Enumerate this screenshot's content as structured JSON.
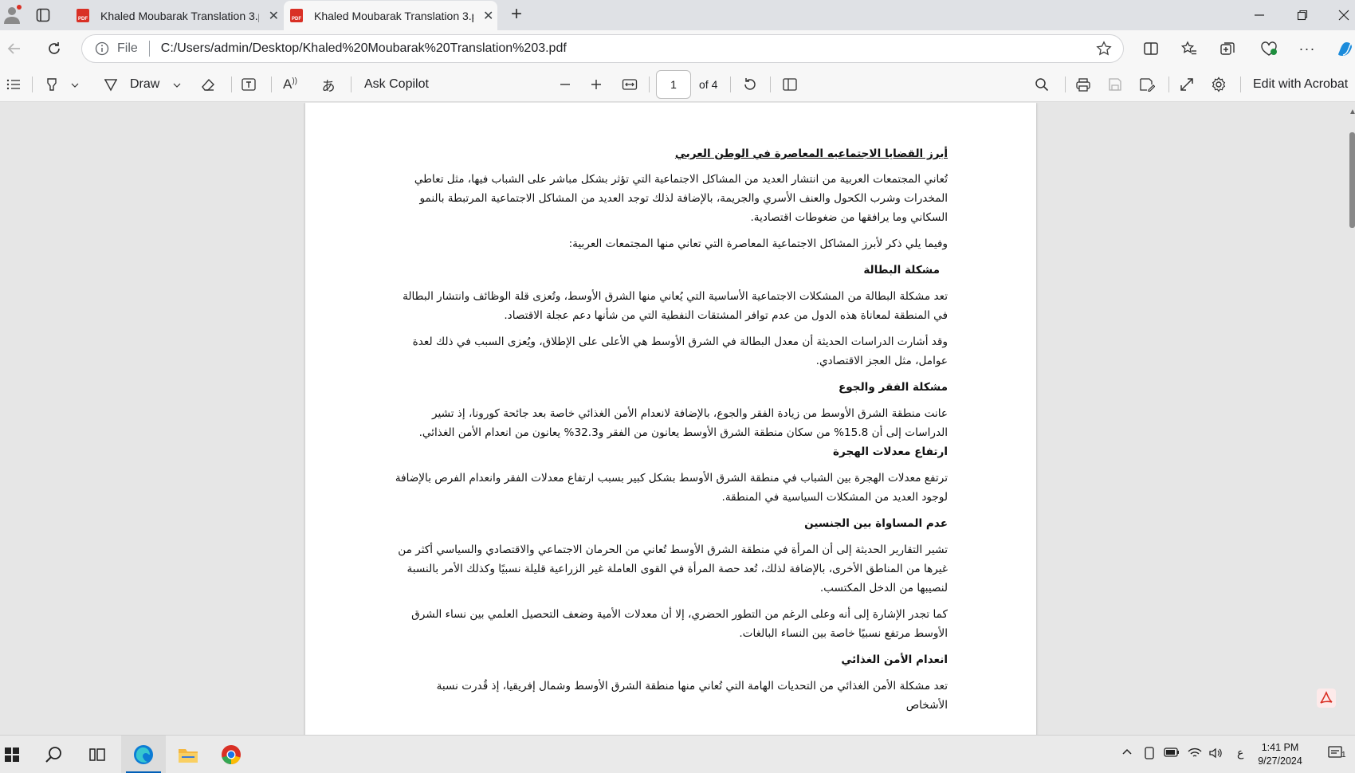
{
  "tabs": [
    {
      "title": "Khaled Moubarak Translation 3.pdf",
      "active": false,
      "icon": "pdf-icon"
    },
    {
      "title": "Khaled Moubarak Translation 3.pdf",
      "active": true,
      "icon": "pdf-icon"
    }
  ],
  "address": {
    "scheme_label": "File",
    "url": "C:/Users/admin/Desktop/Khaled%20Moubarak%20Translation%203.pdf"
  },
  "toolbar": {
    "draw_label": "Draw",
    "ask_copilot": "Ask Copilot",
    "page_current": "1",
    "page_total": "of 4",
    "edit_acrobat": "Edit with Acrobat",
    "pdf_badge": "PDF"
  },
  "document": {
    "title": "أبرز القضايا الاجتماعيه المعاصرة في الوطن العربي",
    "intro": "تُعاني المجتمعات العربية من انتشار العديد من المشاكل الاجتماعية التي تؤثر بشكل مباشر على الشباب فيها، مثل تعاطي المخدرات وشرب الكحول والعنف الأسري والجريمة، بالإضافة لذلك توجد العديد من المشاكل الاجتماعية المرتبطة بالنمو السكاني وما يرافقها من ضغوطات اقتصادية.",
    "lead": "وفيما يلي ذكر لأبرز المشاكل الاجتماعية المعاصرة التي تعاني منها المجتمعات العربية:",
    "h_unemployment": "مشكلة البطالة",
    "p_unemployment_1": "تعد مشكلة البطالة من المشكلات الاجتماعية الأساسية التي يُعاني منها الشرق الأوسط، وتُعزى قلة الوظائف وانتشار البطالة في المنطقة لمعاناة هذه الدول من عدم توافر المشتقات النفطية التي من شأنها دعم عجلة الاقتصاد.",
    "p_unemployment_2": "وقد أشارت الدراسات الحديثة أن معدل البطالة في الشرق الأوسط هي الأعلى على الإطلاق، ويُعزى السبب في ذلك لعدة عوامل، مثل العجز الاقتصادي.",
    "h_poverty": "مشكلة الفقر والجوع",
    "p_poverty": "عانت منطقة الشرق الأوسط من زيادة الفقر والجوع، بالإضافة لانعدام الأمن الغذائي خاصة بعد جائحة كورونا، إذ تشير الدراسات إلى أن 15.8% من سكان منطقة الشرق الأوسط يعانون من الفقر و32.3% يعانون من انعدام الأمن الغذائي.",
    "h_migration": "ارتفاع معدلات الهجرة",
    "p_migration": "ترتفع معدلات الهجرة بين الشباب في منطقة الشرق الأوسط بشكل كبير بسبب ارتفاع معدلات الفقر وانعدام الفرص بالإضافة لوجود العديد من المشكلات السياسية في المنطقة.",
    "h_inequality": "عدم المساواة بين الجنسين",
    "p_inequality_1": "تشير التقارير الحديثة إلى أن المرأة في منطقة الشرق الأوسط تُعاني من الحرمان الاجتماعي والاقتصادي والسياسي أكثر من غيرها من المناطق الأخرى، بالإضافة لذلك، تُعد حصة المرأة في القوى العاملة غير الزراعية قليلة نسبيًا وكذلك الأمر بالنسبة لنصيبها من الدخل المكتسب.",
    "p_inequality_2": "كما تجدر الإشارة إلى أنه وعلى الرغم من التطور الحضري، إلا أن معدلات الأمية وضعف التحصيل العلمي بين نساء الشرق الأوسط مرتفع نسبيًا خاصة بين النساء البالغات.",
    "h_food": "انعدام الأمن الغذائي",
    "p_food": "تعد مشكلة الأمن الغذائي من التحديات الهامة التي تُعاني منها منطقة الشرق الأوسط وشمال إفريقيا، إذ قُدرت نسبة الأشخاص"
  },
  "taskbar": {
    "time": "1:41 PM",
    "date": "9/27/2024",
    "lang": "ع",
    "notifications": "1"
  },
  "colors": {
    "accent": "#005fb8",
    "pdf_red": "#d93025",
    "edge_blue": "#0c7cd5",
    "chrome_green": "#34a853"
  }
}
